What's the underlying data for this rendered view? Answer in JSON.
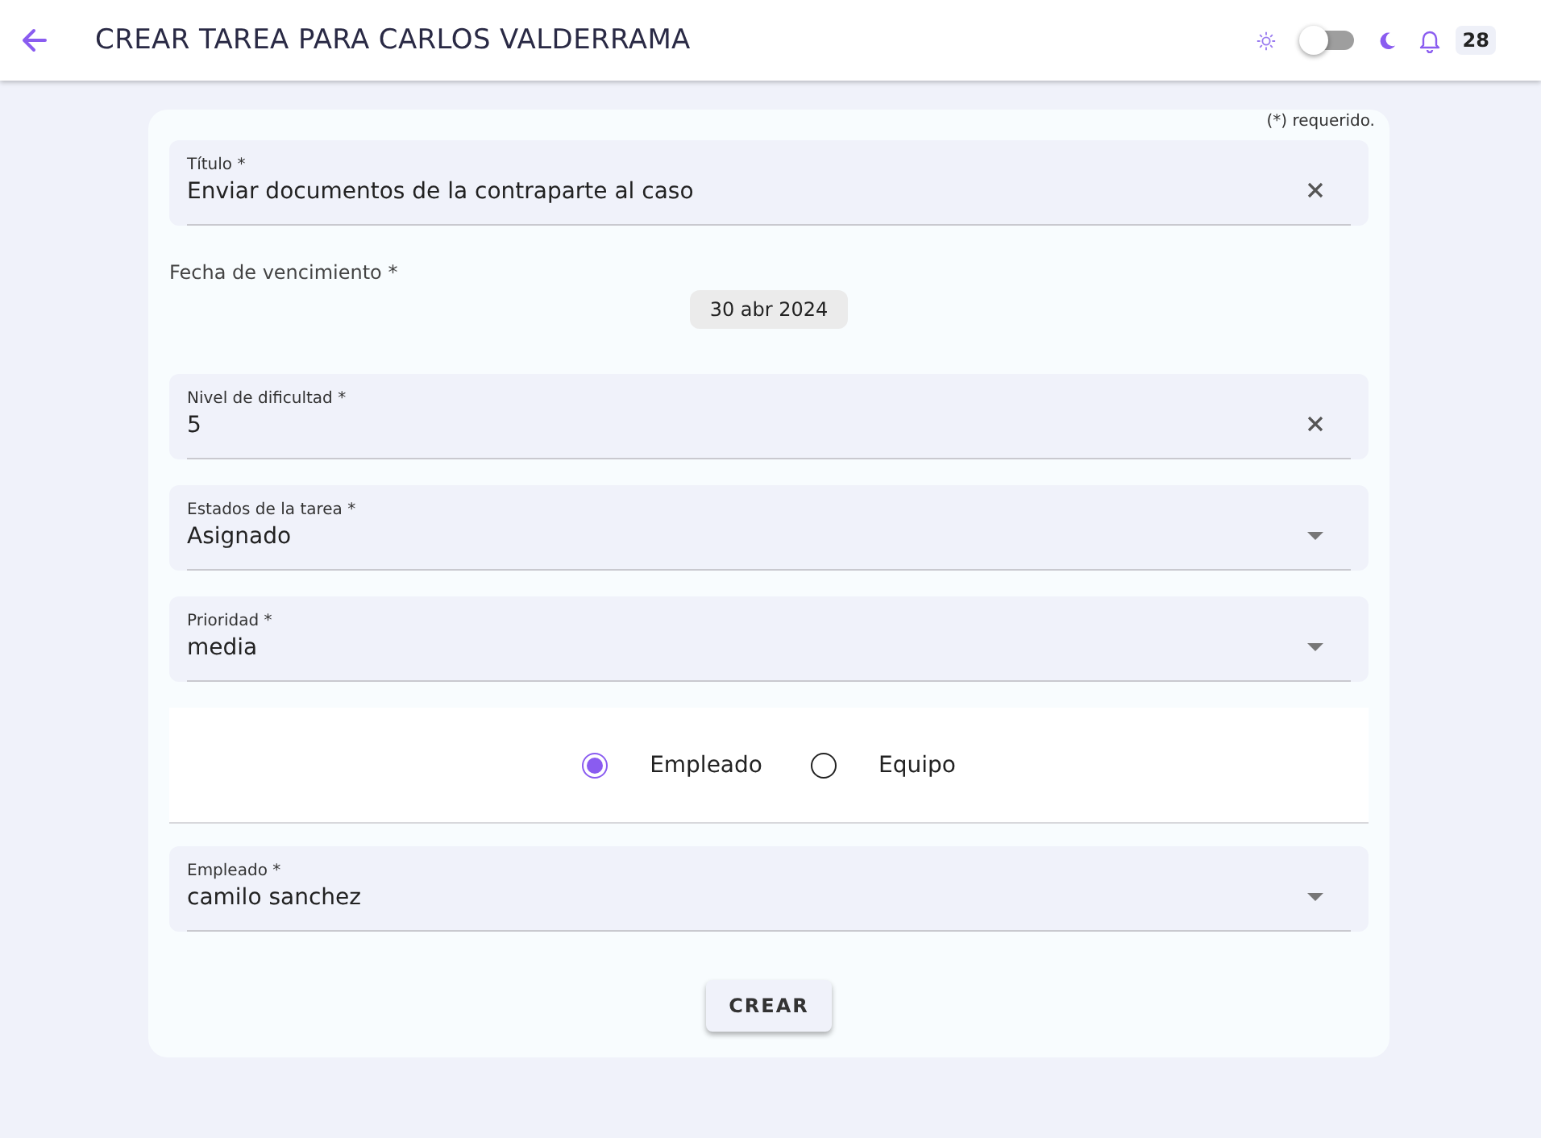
{
  "header": {
    "title": "CREAR TAREA PARA CARLOS VALDERRAMA",
    "theme_toggle": {
      "on": false
    },
    "notifications": {
      "count": "28"
    }
  },
  "form": {
    "required_note": "(*) requerido.",
    "items": [
      {
        "kind": "text",
        "label": "Título *",
        "value": "Enviar documentos de la contraparte al caso"
      },
      {
        "kind": "date",
        "label": "Fecha de vencimiento *",
        "value": "30 abr 2024"
      },
      {
        "kind": "text",
        "label": "Nivel de dificultad *",
        "value": "5"
      },
      {
        "kind": "select",
        "label": "Estados de la tarea *",
        "value": "Asignado"
      },
      {
        "kind": "select",
        "label": "Prioridad *",
        "value": "media"
      },
      {
        "kind": "radio",
        "options": [
          {
            "label": "Empleado",
            "selected": true
          },
          {
            "label": "Equipo",
            "selected": false
          }
        ]
      },
      {
        "kind": "select",
        "label": "Empleado *",
        "value": "camilo sanchez"
      }
    ],
    "submit": "CREAR"
  }
}
